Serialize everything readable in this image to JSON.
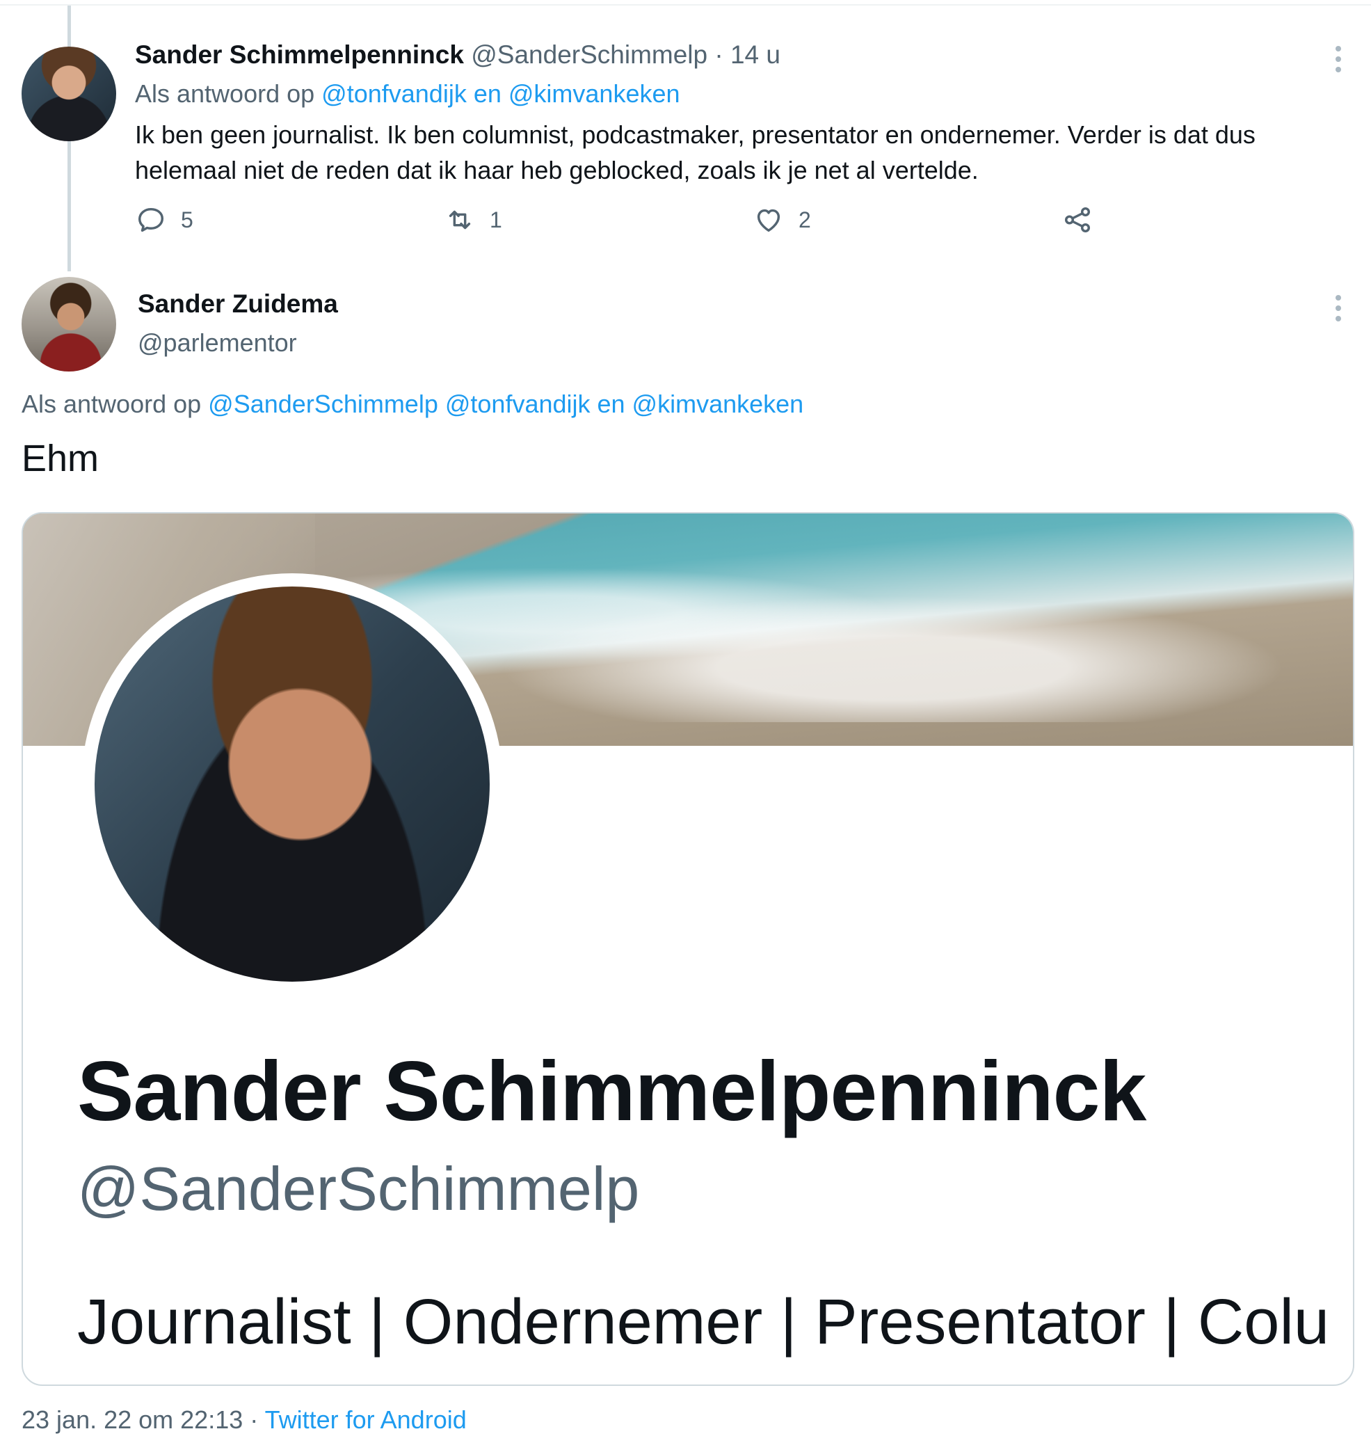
{
  "tweet1": {
    "author_name": "Sander Schimmelpenninck",
    "author_handle": "@SanderSchimmelp",
    "time": "· 14 u",
    "reply_prefix": "Als antwoord op",
    "reply_targets": "@tonfvandijk en @kimvankeken",
    "text": "Ik ben geen journalist. Ik ben columnist, podcastmaker, presentator en ondernemer. Verder is dat dus helemaal niet de reden dat ik haar heb geblocked, zoals ik je net al vertelde.",
    "replies": "5",
    "retweets": "1",
    "likes": "2"
  },
  "tweet2": {
    "author_name": "Sander Zuidema",
    "author_handle": "@parlementor",
    "reply_prefix": "Als antwoord op",
    "reply_targets": "@SanderSchimmelp @tonfvandijk en @kimvankeken",
    "text": "Ehm",
    "card": {
      "name": "Sander Schimmelpenninck",
      "handle": "@SanderSchimmelp",
      "bio": "Journalist | Ondernemer | Presentator | Colu"
    },
    "date": "23 jan. 22 om 22:13",
    "separator": "·",
    "source": "Twitter for Android"
  },
  "colors": {
    "link": "#1d9bf0",
    "muted": "#536471",
    "text": "#0f1419",
    "thread_line": "#cfd9de"
  },
  "icons": {
    "reply": "reply-icon",
    "retweet": "retweet-icon",
    "like": "heart-icon",
    "share": "share-icon",
    "more": "more-vertical-icon"
  }
}
